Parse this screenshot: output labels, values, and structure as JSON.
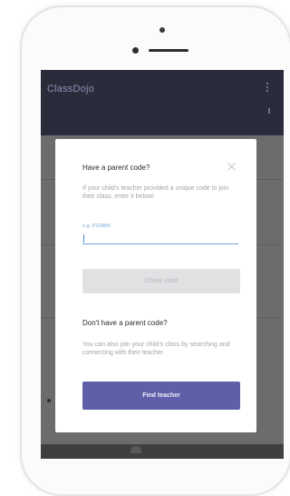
{
  "app": {
    "title": "ClassDojo"
  },
  "dialog": {
    "title": "Have a parent code?",
    "description": "If your child's teacher provided a unique code to join their class, enter it below!",
    "input_label": "e.g. P12AB6",
    "input_value": "",
    "check_label": "Check code",
    "title2": "Don't have a parent code?",
    "description2": "You can also join your child's class by searching and connecting with their teacher.",
    "find_label": "Find teacher"
  },
  "colors": {
    "app_bar": "#2b2c3b",
    "overlay": "#6b6c6d",
    "accent": "#5e5fa8",
    "input_focus": "#73a3d8"
  },
  "icons": {
    "close": "close-icon",
    "menu": "more-vertical-icon"
  }
}
